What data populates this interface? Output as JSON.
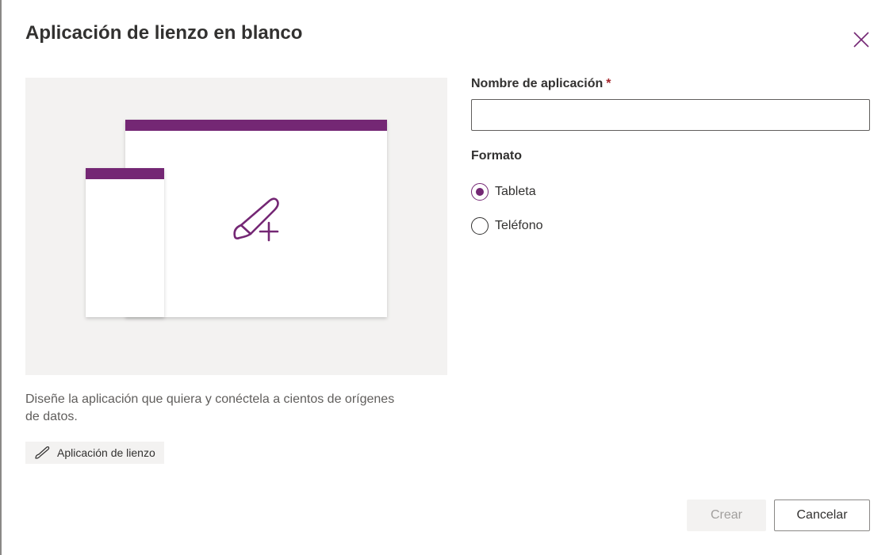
{
  "dialog": {
    "title": "Aplicación de lienzo en blanco",
    "description": "Diseñe la aplicación que quiera y conéctela a cientos de orígenes de datos.",
    "tag_label": "Aplicación de lienzo",
    "close_icon": "close-icon"
  },
  "form": {
    "name_label": "Nombre de aplicación",
    "name_required_mark": "*",
    "name_value": "",
    "format_label": "Formato",
    "format_options": [
      {
        "label": "Tableta",
        "selected": true
      },
      {
        "label": "Teléfono",
        "selected": false
      }
    ]
  },
  "buttons": {
    "create_label": "Crear",
    "create_enabled": false,
    "cancel_label": "Cancelar"
  },
  "colors": {
    "accent": "#742774",
    "illustration_bg": "#f3f2f1",
    "required": "#a4262c"
  }
}
